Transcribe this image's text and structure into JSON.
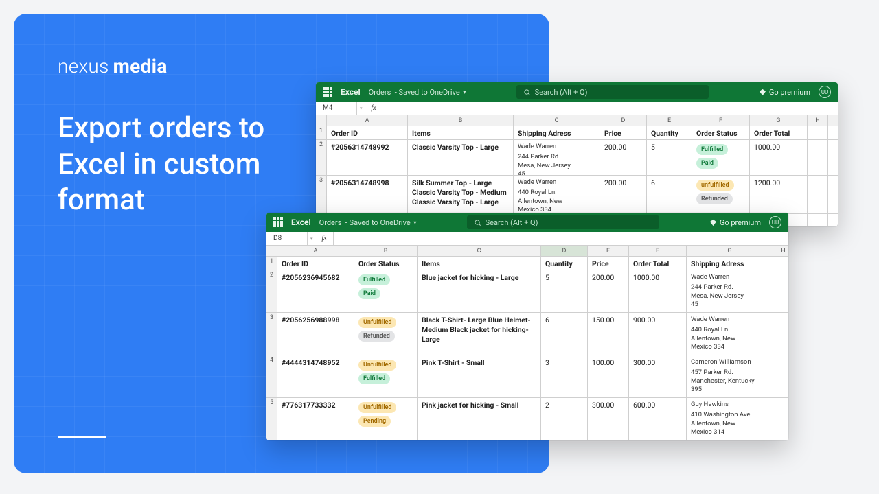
{
  "brand": {
    "part1": "nexus",
    "part2": "media"
  },
  "heading": "Export orders to Excel in custom format",
  "excel_ui": {
    "app": "Excel",
    "doc": "Orders",
    "saved": "Saved to OneDrive",
    "search_placeholder": "Search (Alt + Q)",
    "premium": "Go premium",
    "avatar": "UU"
  },
  "back": {
    "cellref": "M4",
    "cols": [
      "A",
      "B",
      "C",
      "D",
      "E",
      "F",
      "G",
      "H",
      "I"
    ],
    "headers": [
      "Order ID",
      "Items",
      "Shipping Adress",
      "Price",
      "Quantity",
      "Order Status",
      "Order Total",
      "",
      ""
    ],
    "rows": [
      {
        "rowNum": "2",
        "id": "#2056314748992",
        "items": [
          "Classic Varsity Top - Large"
        ],
        "ship": {
          "name": "Wade Warren",
          "l1": "244 Parker Rd.",
          "l2": "Mesa, New Jersey",
          "l3": "45"
        },
        "price": "200.00",
        "qty": "5",
        "status": [
          {
            "cls": "green",
            "t": "Fulfilled"
          },
          {
            "cls": "green",
            "t": "Paid"
          }
        ],
        "total": "1000.00"
      },
      {
        "rowNum": "3",
        "id": "#2056314748998",
        "items": [
          "Silk Summer Top - Large",
          "Classic Varsity Top - Medium",
          "Classic Varsity Top - Large"
        ],
        "ship": {
          "name": "Wade Warren",
          "l1": "440 Royal Ln.",
          "l2": "Allentown, New",
          "l3": "Mexico 334"
        },
        "price": "200.00",
        "qty": "6",
        "status": [
          {
            "cls": "amber",
            "t": "unfulfilled"
          },
          {
            "cls": "gray",
            "t": "Refunded"
          }
        ],
        "total": "1200.00"
      }
    ]
  },
  "front": {
    "cellref": "D8",
    "cols": [
      "A",
      "B",
      "C",
      "D",
      "E",
      "F",
      "G",
      "H"
    ],
    "activeCol": 3,
    "headers": [
      "Order ID",
      "Order Status",
      "Items",
      "Quantity",
      "Price",
      "Order Total",
      "Shipping Adress",
      ""
    ],
    "rows": [
      {
        "rowNum": "2",
        "id": "#2056236945682",
        "status": [
          {
            "cls": "green",
            "t": "Fulfilled"
          },
          {
            "cls": "green",
            "t": "Paid"
          }
        ],
        "items": [
          "Blue jacket for hicking - Large"
        ],
        "qty": "5",
        "price": "200.00",
        "total": "1000.00",
        "ship": {
          "name": "Wade Warren",
          "l1": "244 Parker Rd.",
          "l2": "Mesa, New Jersey",
          "l3": "45"
        }
      },
      {
        "rowNum": "3",
        "id": "#2056256988998",
        "status": [
          {
            "cls": "amber",
            "t": "Unfulfilled"
          },
          {
            "cls": "gray",
            "t": "Refunded"
          }
        ],
        "items": [
          "Black T-Shirt- Large Blue Helmet- Medium Black jacket for hicking- Large"
        ],
        "qty": "6",
        "price": "150.00",
        "total": "900.00",
        "ship": {
          "name": "Wade Warren",
          "l1": "440 Royal Ln.",
          "l2": "Allentown, New",
          "l3": "Mexico 334"
        }
      },
      {
        "rowNum": "4",
        "id": "#4444314748952",
        "status": [
          {
            "cls": "amber",
            "t": "Unfulfilled"
          },
          {
            "cls": "green",
            "t": "Fulfilled"
          }
        ],
        "items": [
          "Pink T-Shirt - Small"
        ],
        "qty": "3",
        "price": "100.00",
        "total": "300.00",
        "ship": {
          "name": "Cameron Williamson",
          "l1": "457 Parker Rd.",
          "l2": "Manchester, Kentucky",
          "l3": "395"
        }
      },
      {
        "rowNum": "5",
        "id": "#776317733332",
        "status": [
          {
            "cls": "amber",
            "t": "Unfulfilled"
          },
          {
            "cls": "amber",
            "t": "Pending"
          }
        ],
        "items": [
          "Pink jacket for hicking - Small"
        ],
        "qty": "2",
        "price": "300.00",
        "total": "600.00",
        "ship": {
          "name": "Guy Hawkins",
          "l1": "410  Washington Ave",
          "l2": "Allentown, New",
          "l3": "Mexico 314"
        }
      }
    ]
  }
}
